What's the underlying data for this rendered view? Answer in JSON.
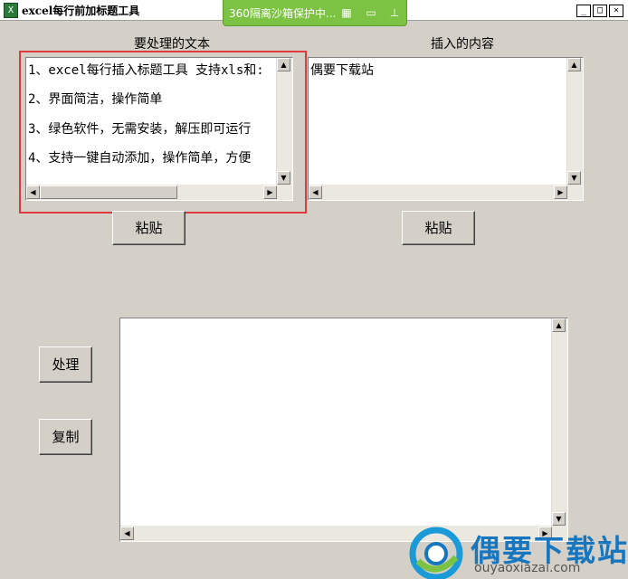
{
  "window": {
    "title": "excel每行前加标题工具"
  },
  "sandbox_bar": {
    "text": "360隔离沙箱保护中..."
  },
  "labels": {
    "source_text": "要处理的文本",
    "insert_content": "插入的内容"
  },
  "source_textbox": {
    "lines": [
      "1、excel每行插入标题工具 支持xls和:",
      "2、界面简洁，操作简单",
      "3、绿色软件，无需安装，解压即可运行",
      "4、支持一键自动添加，操作简单，方便"
    ]
  },
  "insert_textbox": {
    "value": "偶要下载站"
  },
  "buttons": {
    "paste_left": "粘贴",
    "paste_right": "粘贴",
    "process": "处理",
    "copy": "复制"
  },
  "output_textbox": {
    "value": ""
  },
  "watermark": {
    "brand": "偶要下载站",
    "url": "ouyaoxiazai.com"
  },
  "colors": {
    "window_bg": "#d4d0c8",
    "highlight_border": "#e0393e",
    "sandbox_green": "#7cc243",
    "brand_blue": "#1676bf"
  }
}
